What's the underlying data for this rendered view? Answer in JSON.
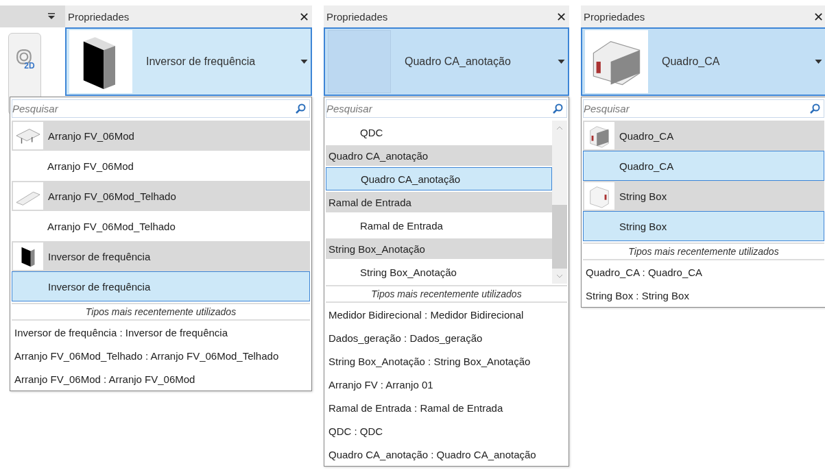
{
  "left_toolbar": {
    "view_label": "2D"
  },
  "panels": [
    {
      "title": "Propriedades",
      "close": "✕",
      "preview": {
        "thumbnail": {
          "kind": "inverter"
        },
        "name": "Inversor de frequência"
      },
      "search": {
        "placeholder": "Pesquisar"
      },
      "scrollbar": false,
      "items": [
        {
          "kind": "family",
          "thumbnail": {
            "kind": "array"
          },
          "label": "Arranjo FV_06Mod",
          "selected": false
        },
        {
          "kind": "type",
          "label": "Arranjo FV_06Mod",
          "selected": false
        },
        {
          "kind": "family",
          "thumbnail": {
            "kind": "roof"
          },
          "label": "Arranjo FV_06Mod_Telhado",
          "selected": false
        },
        {
          "kind": "type",
          "label": "Arranjo FV_06Mod_Telhado",
          "selected": false
        },
        {
          "kind": "family",
          "thumbnail": {
            "kind": "inverter"
          },
          "label": "Inversor de frequência",
          "selected": false
        },
        {
          "kind": "type",
          "label": "Inversor de frequência",
          "selected": true
        }
      ],
      "recent_header": "Tipos mais recentemente utilizados",
      "recent": [
        "Inversor de frequência : Inversor de frequência",
        "Arranjo FV_06Mod_Telhado : Arranjo FV_06Mod_Telhado",
        "Arranjo FV_06Mod : Arranjo FV_06Mod"
      ]
    },
    {
      "title": "Propriedades",
      "close": "✕",
      "preview": {
        "name": "Quadro CA_anotação"
      },
      "search": {
        "placeholder": "Pesquisar"
      },
      "scrollbar": true,
      "items": [
        {
          "kind": "type",
          "label": "QDC",
          "selected": false
        },
        {
          "kind": "family",
          "label": "Quadro CA_anotação",
          "selected": false
        },
        {
          "kind": "type",
          "label": "Quadro CA_anotação",
          "selected": true
        },
        {
          "kind": "family",
          "label": "Ramal de Entrada",
          "selected": false
        },
        {
          "kind": "type",
          "label": "Ramal de Entrada",
          "selected": false
        },
        {
          "kind": "family",
          "label": "String Box_Anotação",
          "selected": false
        },
        {
          "kind": "type",
          "label": "String Box_Anotação",
          "selected": false
        }
      ],
      "recent_header": "Tipos mais recentemente utilizados",
      "recent": [
        "Medidor Bidirecional : Medidor Bidirecional",
        "Dados_geração : Dados_geração",
        "String Box_Anotação : String Box_Anotação",
        "Arranjo FV : Arranjo 01",
        "Ramal de Entrada : Ramal de Entrada",
        "QDC : QDC",
        "Quadro CA_anotação : Quadro CA_anotação"
      ]
    },
    {
      "title": "Propriedades",
      "close": "✕",
      "preview": {
        "thumbnail": {
          "kind": "enclosure"
        },
        "name": "Quadro_CA"
      },
      "search": {
        "placeholder": "Pesquisar"
      },
      "scrollbar": false,
      "items": [
        {
          "kind": "family",
          "thumbnail": {
            "kind": "enclosure"
          },
          "label": "Quadro_CA",
          "selected": false
        },
        {
          "kind": "type",
          "label": "Quadro_CA",
          "selected": true
        },
        {
          "kind": "family",
          "thumbnail": {
            "kind": "stringbox"
          },
          "label": "String Box",
          "selected": false
        },
        {
          "kind": "type",
          "label": "String Box",
          "selected": true
        }
      ],
      "recent_header": "Tipos mais recentemente utilizados",
      "recent": [
        "Quadro_CA : Quadro_CA",
        "String Box : String Box"
      ]
    }
  ]
}
